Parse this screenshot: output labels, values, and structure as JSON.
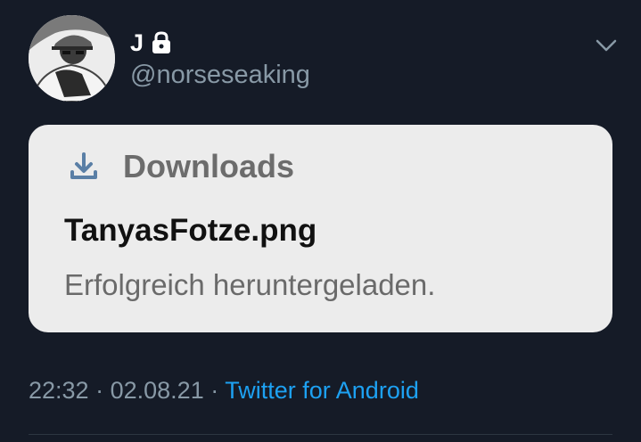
{
  "user": {
    "display_name": "J",
    "handle": "@norseseaking",
    "avatar_icon": "person-with-cap-avatar",
    "protected_icon": "lock-icon"
  },
  "menu": {
    "icon": "chevron-down-icon"
  },
  "notification": {
    "icon": "download-icon",
    "app_name": "Downloads",
    "file_name": "TanyasFotze.png",
    "status": "Erfolgreich heruntergeladen."
  },
  "meta": {
    "time": "22:32",
    "separator": "·",
    "date": "02.08.21",
    "source": "Twitter for Android"
  },
  "colors": {
    "background": "#151b27",
    "card_background": "#ececec",
    "link": "#1da1f2",
    "muted": "#8899a6"
  }
}
